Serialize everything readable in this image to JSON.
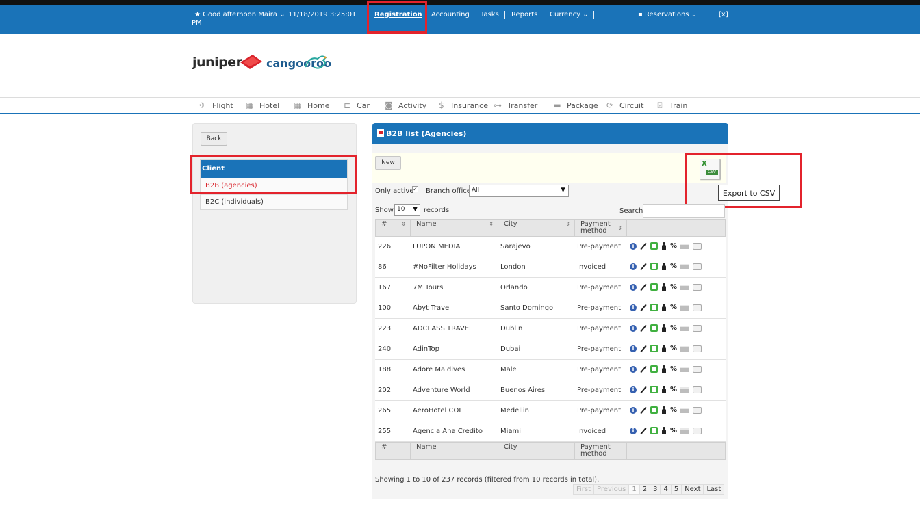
{
  "topbar": {
    "greeting": "Good afternoon Maira",
    "greeting_suffix": "PM",
    "datetime": "11/18/2019 3:25:01",
    "nav": {
      "registration": "Registration",
      "accounting": "Accounting",
      "tasks": "Tasks",
      "reports": "Reports",
      "currency": "Currency",
      "reservations": "Reservations",
      "close": "[x]"
    }
  },
  "logos": {
    "juniper": "juniper",
    "cangooroo": "cangooroo"
  },
  "product_nav": [
    {
      "label": "Flight",
      "icon": "plane-icon"
    },
    {
      "label": "Hotel",
      "icon": "building-icon"
    },
    {
      "label": "Home",
      "icon": "home-building-icon"
    },
    {
      "label": "Car",
      "icon": "car-icon"
    },
    {
      "label": "Activity",
      "icon": "camera-icon"
    },
    {
      "label": "Insurance",
      "icon": "dollar-icon"
    },
    {
      "label": "Transfer",
      "icon": "bus-icon"
    },
    {
      "label": "Package",
      "icon": "briefcase-icon"
    },
    {
      "label": "Circuit",
      "icon": "circuit-icon"
    },
    {
      "label": "Train",
      "icon": "train-icon"
    }
  ],
  "sidebar": {
    "back": "Back",
    "section": "Client",
    "items": [
      {
        "label": "B2B (agencies)",
        "active": true
      },
      {
        "label": "B2C (individuals)",
        "active": false
      }
    ]
  },
  "main": {
    "title": "B2B list (Agencies)",
    "new_button": "New",
    "export_tooltip": "Export to CSV",
    "only_active": "Only active",
    "branch_office_label": "Branch office",
    "branch_office_value": "All",
    "show_label": "Show",
    "show_value": "10",
    "records_label": "records",
    "search_label": "Search",
    "columns": [
      "#",
      "Name",
      "City",
      "Payment method"
    ],
    "rows": [
      {
        "id": "226",
        "name": "LUPON MEDIA",
        "city": "Sarajevo",
        "payment": "Pre-payment"
      },
      {
        "id": "86",
        "name": "#NoFilter Holidays",
        "city": "London",
        "payment": "Invoiced"
      },
      {
        "id": "167",
        "name": "7M Tours",
        "city": "Orlando",
        "payment": "Pre-payment"
      },
      {
        "id": "100",
        "name": "Abyt Travel",
        "city": "Santo Domingo",
        "payment": "Pre-payment"
      },
      {
        "id": "223",
        "name": "ADCLASS TRAVEL",
        "city": "Dublin",
        "payment": "Pre-payment"
      },
      {
        "id": "240",
        "name": "AdinTop",
        "city": "Dubai",
        "payment": "Pre-payment"
      },
      {
        "id": "188",
        "name": "Adore Maldives",
        "city": "Male",
        "payment": "Pre-payment"
      },
      {
        "id": "202",
        "name": "Adventure World",
        "city": "Buenos Aires",
        "payment": "Pre-payment"
      },
      {
        "id": "265",
        "name": "AeroHotel COL",
        "city": "Medellin",
        "payment": "Pre-payment"
      },
      {
        "id": "255",
        "name": "Agencia Ana Credito",
        "city": "Miami",
        "payment": "Invoiced"
      }
    ],
    "showing_text": "Showing 1 to 10 of 237 records (filtered from 10 records in total).",
    "pagination": [
      "First",
      "Previous",
      "1",
      "2",
      "3",
      "4",
      "5",
      "Next",
      "Last"
    ]
  },
  "colors": {
    "brand_blue": "#1a73b8",
    "highlight_red": "#e3232c",
    "active_link": "#d9232b"
  }
}
